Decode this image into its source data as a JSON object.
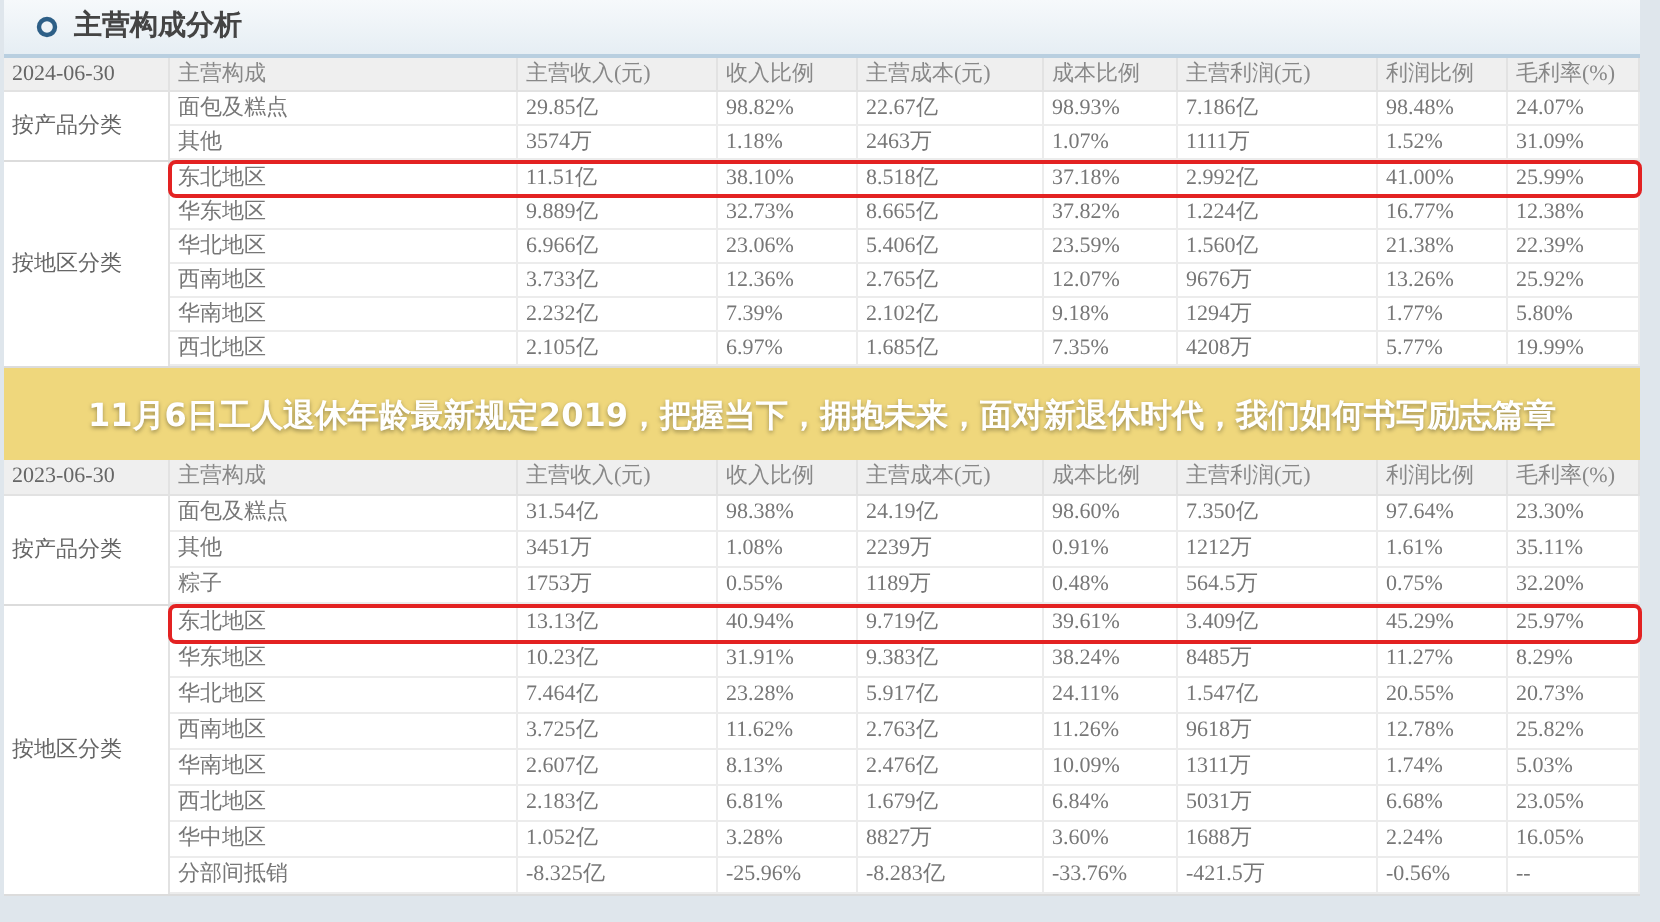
{
  "panel": {
    "title": "主营构成分析"
  },
  "sections": [
    {
      "date": "2024-06-30",
      "columns": [
        "主营构成",
        "主营收入(元)",
        "收入比例",
        "主营成本(元)",
        "成本比例",
        "主营利润(元)",
        "利润比例",
        "毛利率(%)"
      ],
      "groups": [
        {
          "label": "按产品分类",
          "rows": [
            {
              "cells": [
                "面包及糕点",
                "29.85亿",
                "98.82%",
                "22.67亿",
                "98.93%",
                "7.186亿",
                "98.48%",
                "24.07%"
              ],
              "highlighted": false
            },
            {
              "cells": [
                "其他",
                "3574万",
                "1.18%",
                "2463万",
                "1.07%",
                "1111万",
                "1.52%",
                "31.09%"
              ],
              "highlighted": false
            }
          ]
        },
        {
          "label": "按地区分类",
          "rows": [
            {
              "cells": [
                "东北地区",
                "11.51亿",
                "38.10%",
                "8.518亿",
                "37.18%",
                "2.992亿",
                "41.00%",
                "25.99%"
              ],
              "highlighted": true
            },
            {
              "cells": [
                "华东地区",
                "9.889亿",
                "32.73%",
                "8.665亿",
                "37.82%",
                "1.224亿",
                "16.77%",
                "12.38%"
              ],
              "highlighted": false
            },
            {
              "cells": [
                "华北地区",
                "6.966亿",
                "23.06%",
                "5.406亿",
                "23.59%",
                "1.560亿",
                "21.38%",
                "22.39%"
              ],
              "highlighted": false
            },
            {
              "cells": [
                "西南地区",
                "3.733亿",
                "12.36%",
                "2.765亿",
                "12.07%",
                "9676万",
                "13.26%",
                "25.92%"
              ],
              "highlighted": false
            },
            {
              "cells": [
                "华南地区",
                "2.232亿",
                "7.39%",
                "2.102亿",
                "9.18%",
                "1294万",
                "1.77%",
                "5.80%"
              ],
              "highlighted": false
            },
            {
              "cells": [
                "西北地区",
                "2.105亿",
                "6.97%",
                "1.685亿",
                "7.35%",
                "4208万",
                "5.77%",
                "19.99%"
              ],
              "highlighted": false
            }
          ]
        }
      ]
    },
    {
      "date": "2023-06-30",
      "columns": [
        "主营构成",
        "主营收入(元)",
        "收入比例",
        "主营成本(元)",
        "成本比例",
        "主营利润(元)",
        "利润比例",
        "毛利率(%)"
      ],
      "groups": [
        {
          "label": "按产品分类",
          "rows": [
            {
              "cells": [
                "面包及糕点",
                "31.54亿",
                "98.38%",
                "24.19亿",
                "98.60%",
                "7.350亿",
                "97.64%",
                "23.30%"
              ],
              "highlighted": false
            },
            {
              "cells": [
                "其他",
                "3451万",
                "1.08%",
                "2239万",
                "0.91%",
                "1212万",
                "1.61%",
                "35.11%"
              ],
              "highlighted": false
            },
            {
              "cells": [
                "粽子",
                "1753万",
                "0.55%",
                "1189万",
                "0.48%",
                "564.5万",
                "0.75%",
                "32.20%"
              ],
              "highlighted": false
            }
          ]
        },
        {
          "label": "按地区分类",
          "rows": [
            {
              "cells": [
                "东北地区",
                "13.13亿",
                "40.94%",
                "9.719亿",
                "39.61%",
                "3.409亿",
                "45.29%",
                "25.97%"
              ],
              "highlighted": true
            },
            {
              "cells": [
                "华东地区",
                "10.23亿",
                "31.91%",
                "9.383亿",
                "38.24%",
                "8485万",
                "11.27%",
                "8.29%"
              ],
              "highlighted": false
            },
            {
              "cells": [
                "华北地区",
                "7.464亿",
                "23.28%",
                "5.917亿",
                "24.11%",
                "1.547亿",
                "20.55%",
                "20.73%"
              ],
              "highlighted": false
            },
            {
              "cells": [
                "西南地区",
                "3.725亿",
                "11.62%",
                "2.763亿",
                "11.26%",
                "9618万",
                "12.78%",
                "25.82%"
              ],
              "highlighted": false
            },
            {
              "cells": [
                "华南地区",
                "2.607亿",
                "8.13%",
                "2.476亿",
                "10.09%",
                "1311万",
                "1.74%",
                "5.03%"
              ],
              "highlighted": false
            },
            {
              "cells": [
                "西北地区",
                "2.183亿",
                "6.81%",
                "1.679亿",
                "6.84%",
                "5031万",
                "6.68%",
                "23.05%"
              ],
              "highlighted": false
            },
            {
              "cells": [
                "华中地区",
                "1.052亿",
                "3.28%",
                "8827万",
                "3.60%",
                "1688万",
                "2.24%",
                "16.05%"
              ],
              "highlighted": false
            },
            {
              "cells": [
                "分部间抵销",
                "-8.325亿",
                "-25.96%",
                "-8.283亿",
                "-33.76%",
                "-421.5万",
                "-0.56%",
                "--"
              ],
              "highlighted": false
            }
          ]
        }
      ]
    }
  ],
  "banner": {
    "text": "11月6日工人退休年龄最新规定2019，把握当下，拥抱未来，面对新退休时代，我们如何书写励志篇章"
  }
}
